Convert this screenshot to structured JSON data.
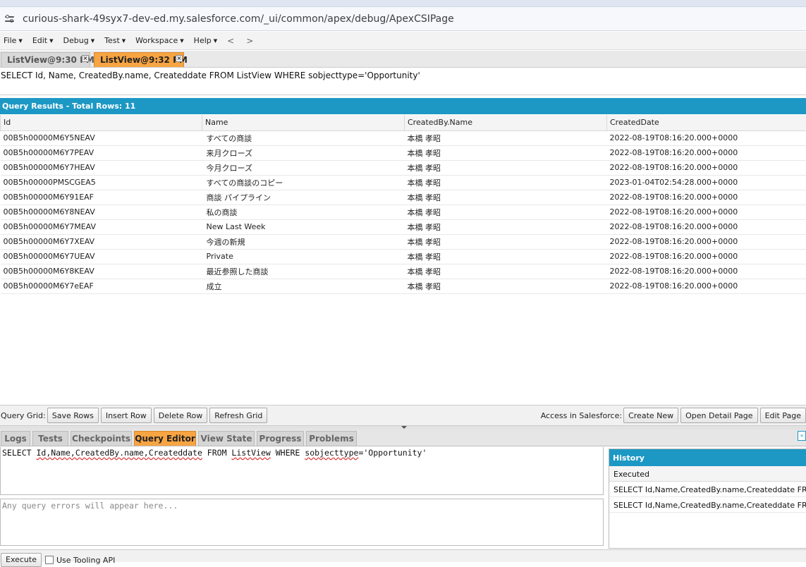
{
  "browser": {
    "url": "curious-shark-49syx7-dev-ed.my.salesforce.com/_ui/common/apex/debug/ApexCSIPage"
  },
  "menu": {
    "items": [
      "File",
      "Edit",
      "Debug",
      "Test",
      "Workspace",
      "Help"
    ],
    "back": "<",
    "forward": ">"
  },
  "file_tabs": [
    {
      "label": "ListView@9:30 PM",
      "close": "×"
    },
    {
      "label": "ListView@9:32 PM",
      "close": "×"
    }
  ],
  "top_query": "SELECT Id, Name, CreatedBy.name, Createddate FROM ListView WHERE sobjecttype='Opportunity'",
  "results": {
    "header": "Query Results - Total Rows: 11",
    "columns": [
      "Id",
      "Name",
      "CreatedBy.Name",
      "CreatedDate"
    ],
    "rows": [
      [
        "00B5h00000M6Y5NEAV",
        "すべての商談",
        "本橋 孝昭",
        "2022-08-19T08:16:20.000+0000"
      ],
      [
        "00B5h00000M6Y7PEAV",
        "来月クローズ",
        "本橋 孝昭",
        "2022-08-19T08:16:20.000+0000"
      ],
      [
        "00B5h00000M6Y7HEAV",
        "今月クローズ",
        "本橋 孝昭",
        "2022-08-19T08:16:20.000+0000"
      ],
      [
        "00B5h00000PMSCGEA5",
        "すべての商談のコピー",
        "本橋 孝昭",
        "2023-01-04T02:54:28.000+0000"
      ],
      [
        "00B5h00000M6Y91EAF",
        "商談 パイプライン",
        "本橋 孝昭",
        "2022-08-19T08:16:20.000+0000"
      ],
      [
        "00B5h00000M6Y8NEAV",
        "私の商談",
        "本橋 孝昭",
        "2022-08-19T08:16:20.000+0000"
      ],
      [
        "00B5h00000M6Y7MEAV",
        "New Last Week",
        "本橋 孝昭",
        "2022-08-19T08:16:20.000+0000"
      ],
      [
        "00B5h00000M6Y7XEAV",
        "今週の新規",
        "本橋 孝昭",
        "2022-08-19T08:16:20.000+0000"
      ],
      [
        "00B5h00000M6Y7UEAV",
        "Private",
        "本橋 孝昭",
        "2022-08-19T08:16:20.000+0000"
      ],
      [
        "00B5h00000M6Y8KEAV",
        "最近参照した商談",
        "本橋 孝昭",
        "2022-08-19T08:16:20.000+0000"
      ],
      [
        "00B5h00000M6Y7eEAF",
        "成立",
        "本橋 孝昭",
        "2022-08-19T08:16:20.000+0000"
      ]
    ]
  },
  "grid_toolbar": {
    "label": "Query Grid:",
    "save_rows": "Save Rows",
    "insert_row": "Insert Row",
    "delete_row": "Delete Row",
    "refresh_grid": "Refresh Grid",
    "access_label": "Access in Salesforce:",
    "create_new": "Create New",
    "open_detail": "Open Detail Page",
    "edit_page": "Edit Page"
  },
  "panel_tabs": [
    "Logs",
    "Tests",
    "Checkpoints",
    "Query Editor",
    "View State",
    "Progress",
    "Problems"
  ],
  "editor": {
    "errors_placeholder": "Any query errors will appear here..."
  },
  "history": {
    "title": "History",
    "column": "Executed",
    "rows": [
      "SELECT Id,Name,CreatedBy.name,Createddate FROM...",
      "SELECT Id,Name,CreatedBy.name,Createddate FROM..."
    ]
  },
  "bottom": {
    "execute": "Execute",
    "use_tooling": "Use Tooling API"
  }
}
